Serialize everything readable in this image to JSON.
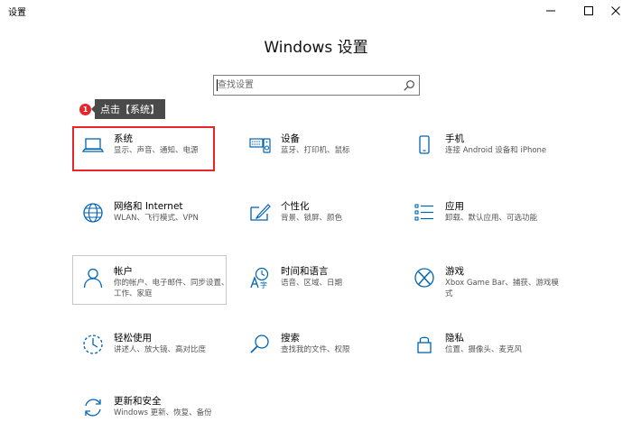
{
  "window": {
    "title": "设置",
    "controls": [
      "minimize",
      "maximize",
      "close"
    ]
  },
  "heading": "Windows 设置",
  "search": {
    "placeholder": "查找设置",
    "value": ""
  },
  "annotation": {
    "badge": "1",
    "text": "点击【系统】"
  },
  "tiles": [
    {
      "id": "system",
      "icon": "laptop-icon",
      "title": "系统",
      "desc": "显示、声音、通知、电源"
    },
    {
      "id": "devices",
      "icon": "keyboard-speaker-icon",
      "title": "设备",
      "desc": "蓝牙、打印机、鼠标"
    },
    {
      "id": "phone",
      "icon": "phone-icon",
      "title": "手机",
      "desc": "连接 Android 设备和 iPhone"
    },
    {
      "id": "network",
      "icon": "globe-icon",
      "title": "网络和 Internet",
      "desc": "WLAN、飞行模式、VPN"
    },
    {
      "id": "personalization",
      "icon": "brush-screen-icon",
      "title": "个性化",
      "desc": "背景、锁屏、颜色"
    },
    {
      "id": "apps",
      "icon": "apps-list-icon",
      "title": "应用",
      "desc": "卸载、默认应用、可选功能"
    },
    {
      "id": "accounts",
      "icon": "person-icon",
      "title": "帐户",
      "desc": "你的帐户、电子邮件、同步设置、工作、家庭"
    },
    {
      "id": "time",
      "icon": "time-language-icon",
      "title": "时间和语言",
      "desc": "语音、区域、日期"
    },
    {
      "id": "gaming",
      "icon": "xbox-icon",
      "title": "游戏",
      "desc": "Xbox Game Bar、捕获、游戏模式"
    },
    {
      "id": "ease",
      "icon": "ease-of-access-icon",
      "title": "轻松使用",
      "desc": "讲述人、放大镜、高对比度"
    },
    {
      "id": "search",
      "icon": "magnifier-icon",
      "title": "搜索",
      "desc": "查找我的文件、权限"
    },
    {
      "id": "privacy",
      "icon": "lock-icon",
      "title": "隐私",
      "desc": "位置、摄像头、麦克风"
    },
    {
      "id": "update",
      "icon": "refresh-icon",
      "title": "更新和安全",
      "desc": "Windows 更新、恢复、备份"
    }
  ],
  "colors": {
    "accent": "#0063b1",
    "highlight": "#e5262a",
    "tooltip_bg": "#4a4a4a"
  }
}
